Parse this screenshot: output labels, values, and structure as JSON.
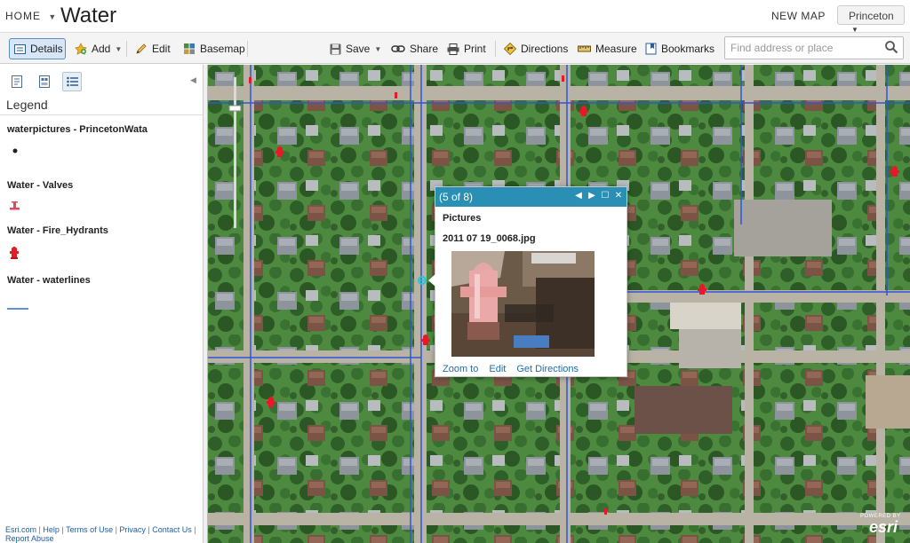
{
  "header": {
    "home_label": "HOME",
    "title": "Water",
    "new_map_label": "NEW MAP",
    "account_label": "Princeton"
  },
  "toolbar": {
    "details_label": "Details",
    "add_label": "Add",
    "edit_label": "Edit",
    "basemap_label": "Basemap",
    "save_label": "Save",
    "share_label": "Share",
    "print_label": "Print",
    "directions_label": "Directions",
    "measure_label": "Measure",
    "bookmarks_label": "Bookmarks",
    "search_placeholder": "Find address or place"
  },
  "sidebar": {
    "tabs": [
      "about-icon",
      "content-icon",
      "legend-icon"
    ],
    "legend_title": "Legend",
    "layers": [
      {
        "name": "waterpictures - PrincetonWata",
        "symbol": "point-dot-icon"
      },
      {
        "name": "Water - Valves",
        "symbol": "valve-icon"
      },
      {
        "name": "Water - Fire_Hydrants",
        "symbol": "fire-hydrant-icon"
      },
      {
        "name": "Water - waterlines",
        "symbol": "waterline-icon"
      }
    ],
    "footer": {
      "links": [
        "Esri.com",
        "Help",
        "Terms of Use",
        "Privacy",
        "Contact Us",
        "Report Abuse"
      ]
    }
  },
  "popup": {
    "counter": "(5 of 8)",
    "layer_title": "Pictures",
    "filename": "2011 07 19_0068.jpg",
    "links": [
      "Zoom to",
      "Edit",
      "Get Directions"
    ]
  },
  "map": {
    "attribution": {
      "powered_by": "POWERED BY",
      "brand": "esri"
    },
    "colors": {
      "waterline": "#2b4fd1",
      "hydrant": "#e8182a",
      "road": "#b3ad9f",
      "grass": "#3f7a35"
    }
  },
  "colors": {
    "accent": "#2a8fb5",
    "link": "#1f6cb0",
    "details_active_bg": "#d6e6f7"
  }
}
